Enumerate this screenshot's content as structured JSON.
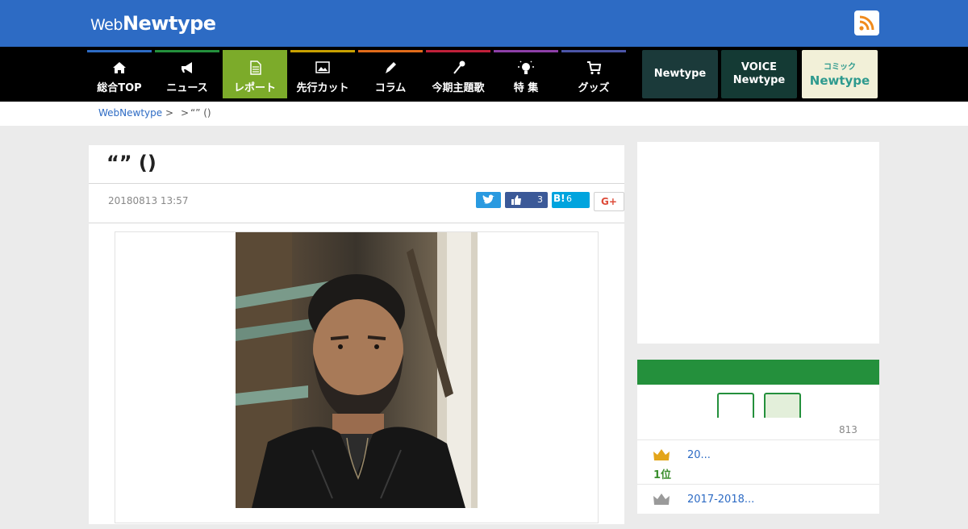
{
  "header": {
    "logo_web": "Web",
    "logo_newtype": "Newtype",
    "rss_icon": "rss-icon"
  },
  "nav": {
    "items": [
      {
        "label": "総合TOP",
        "icon": "home-icon",
        "color": "#2d6bc4"
      },
      {
        "label": "ニュース",
        "icon": "megaphone-icon",
        "color": "#24903c"
      },
      {
        "label": "レポート",
        "icon": "document-icon",
        "color": "#7cab2a"
      },
      {
        "label": "先行カット",
        "icon": "image-icon",
        "color": "#c8a000"
      },
      {
        "label": "コラム",
        "icon": "pen-icon",
        "color": "#e06b1a"
      },
      {
        "label": "今期主題歌",
        "icon": "microphone-icon",
        "color": "#c0203a"
      },
      {
        "label": "特 集",
        "icon": "lightbulb-icon",
        "color": "#8d3fa8"
      },
      {
        "label": "グッズ",
        "icon": "cart-icon",
        "color": "#4b55a8"
      }
    ],
    "banners": [
      {
        "label": "Newtype"
      },
      {
        "label1": "VOICE",
        "label2": "Newtype"
      },
      {
        "label1": "コミック",
        "label2": "Newtype"
      }
    ]
  },
  "breadcrumb": {
    "home": "WebNewtype",
    "sep1": ">",
    "sep2": ">",
    "current": "“” ()"
  },
  "article": {
    "title": "“” ()",
    "date": "20180813 13:57",
    "share": {
      "like_count": "3",
      "hatena_label": "B!",
      "hatena_count": "6",
      "gplus_label": "G+"
    }
  },
  "sidebar": {
    "ranking": {
      "date": "813",
      "items": [
        {
          "rank": "1位",
          "text": "20..."
        },
        {
          "rank": "",
          "text": "2017-2018..."
        }
      ]
    }
  },
  "colors": {
    "header_blue": "#2d6bc4",
    "ranking_green": "#24903c",
    "active_nav": "#7cab2a"
  }
}
